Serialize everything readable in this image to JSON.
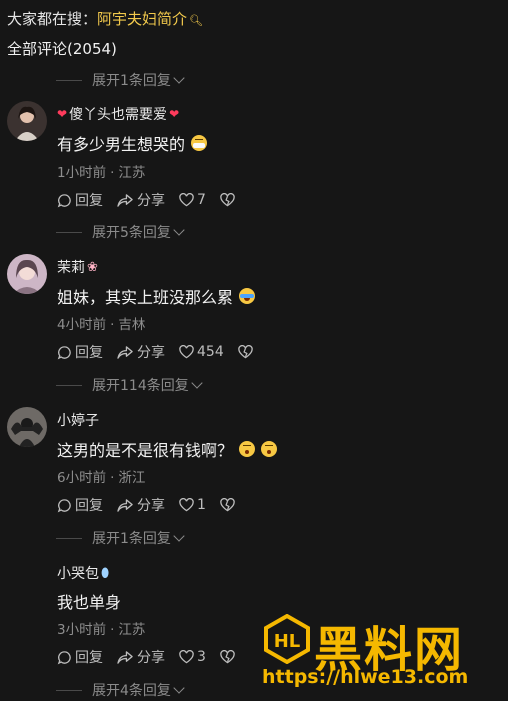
{
  "search": {
    "prefix": "大家都在搜：",
    "keyword": "阿宇夫妇简介"
  },
  "comments_total": "全部评论(2054)",
  "expands": [
    "展开1条回复",
    "展开5条回复",
    "展开114条回复",
    "展开1条回复",
    "展开4条回复"
  ],
  "comments": [
    {
      "name": "傻丫头也需要爱",
      "text": "有多少男生想哭的",
      "emoji": "mask-face",
      "time": "1小时前",
      "location": "江苏",
      "likes": "7"
    },
    {
      "name": "茉莉",
      "text": "姐妹，其实上班没那么累",
      "emoji": "rofl-face",
      "time": "4小时前",
      "location": "吉林",
      "likes": "454"
    },
    {
      "name": "小婷子",
      "text": "这男的是不是很有钱啊？",
      "emoji": "hushed-face",
      "time": "6小时前",
      "location": "浙江",
      "likes": "1"
    },
    {
      "name": "小哭包",
      "text": "我也单身",
      "emoji": "",
      "time": "3小时前",
      "location": "江苏",
      "likes": "3"
    }
  ],
  "actions": {
    "reply": "回复",
    "share": "分享"
  },
  "watermark": {
    "brand": "黑料网",
    "url": "https://hlwe13.com",
    "logo_text": "HL"
  },
  "colors": {
    "background": "#161616",
    "accent": "#f2c94c",
    "watermark": "#f5b800"
  }
}
